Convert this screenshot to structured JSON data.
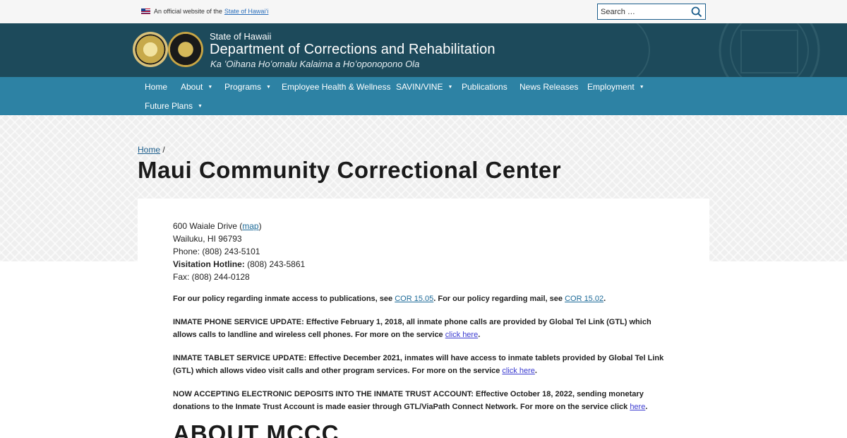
{
  "topbar": {
    "official_prefix": "An official website of the",
    "official_link": "State of Hawaiʻi",
    "search_placeholder": "Search …"
  },
  "header": {
    "state": "State of Hawaii",
    "department": "Department of Corrections and Rehabilitation",
    "subtitle": "Ka ʻOihana Hoʻomalu Kalaima a Hoʻoponopono Ola"
  },
  "nav": {
    "items": [
      {
        "label": "Home",
        "has_submenu": false
      },
      {
        "label": "About",
        "has_submenu": true
      },
      {
        "label": "Programs",
        "has_submenu": true
      },
      {
        "label": "Employee Health & Wellness",
        "has_submenu": false
      },
      {
        "label": "SAVIN/VINE",
        "has_submenu": true
      },
      {
        "label": "Publications",
        "has_submenu": false
      },
      {
        "label": "News Releases",
        "has_submenu": false
      },
      {
        "label": "Employment",
        "has_submenu": true
      },
      {
        "label": "Future Plans",
        "has_submenu": true
      }
    ]
  },
  "breadcrumb": {
    "home": "Home",
    "separator": "/"
  },
  "page_title": "Maui Community Correctional Center",
  "address": {
    "street": "600 Waiale Drive (",
    "map_link": "map",
    "street_close": ")",
    "city": "Wailuku, HI 96793",
    "phone": "Phone: (808) 243-5101",
    "visitation_label": "Visitation Hotline:",
    "visitation_number": " (808) 243-5861",
    "fax": "Fax: (808) 244-0128"
  },
  "policy": {
    "text1": "For our policy regarding inmate access to publications, see ",
    "link1": "COR 15.05",
    "text2": ". For our policy regarding mail, see ",
    "link2": "COR 15.02",
    "text3": "."
  },
  "phone_update": {
    "text": "INMATE PHONE SERVICE UPDATE: Effective February 1, 2018, all inmate phone calls are provided by Global Tel Link (GTL) which allows calls to landline and wireless cell phones. For more on the service ",
    "link": "click here",
    "end": "."
  },
  "tablet_update": {
    "text": "INMATE TABLET SERVICE UPDATE: Effective December 2021, inmates will have access to inmate tablets provided by Global Tel Link (GTL) which allows video visit calls and other program services. For more on the service ",
    "link": "click here",
    "end": "."
  },
  "deposits_update": {
    "text": "NOW ACCEPTING ELECTRONIC DEPOSITS INTO THE INMATE TRUST ACCOUNT: Effective October 18, 2022, sending monetary donations to the Inmate Trust Account is made easier through GTL/ViaPath Connect Network.  For more on the service click ",
    "link": "here",
    "end": "."
  },
  "about_heading": "ABOUT MCCC",
  "colors": {
    "header_bg": "#1d4a5b",
    "nav_bg": "#2d82a4",
    "link": "#1c6a98"
  }
}
